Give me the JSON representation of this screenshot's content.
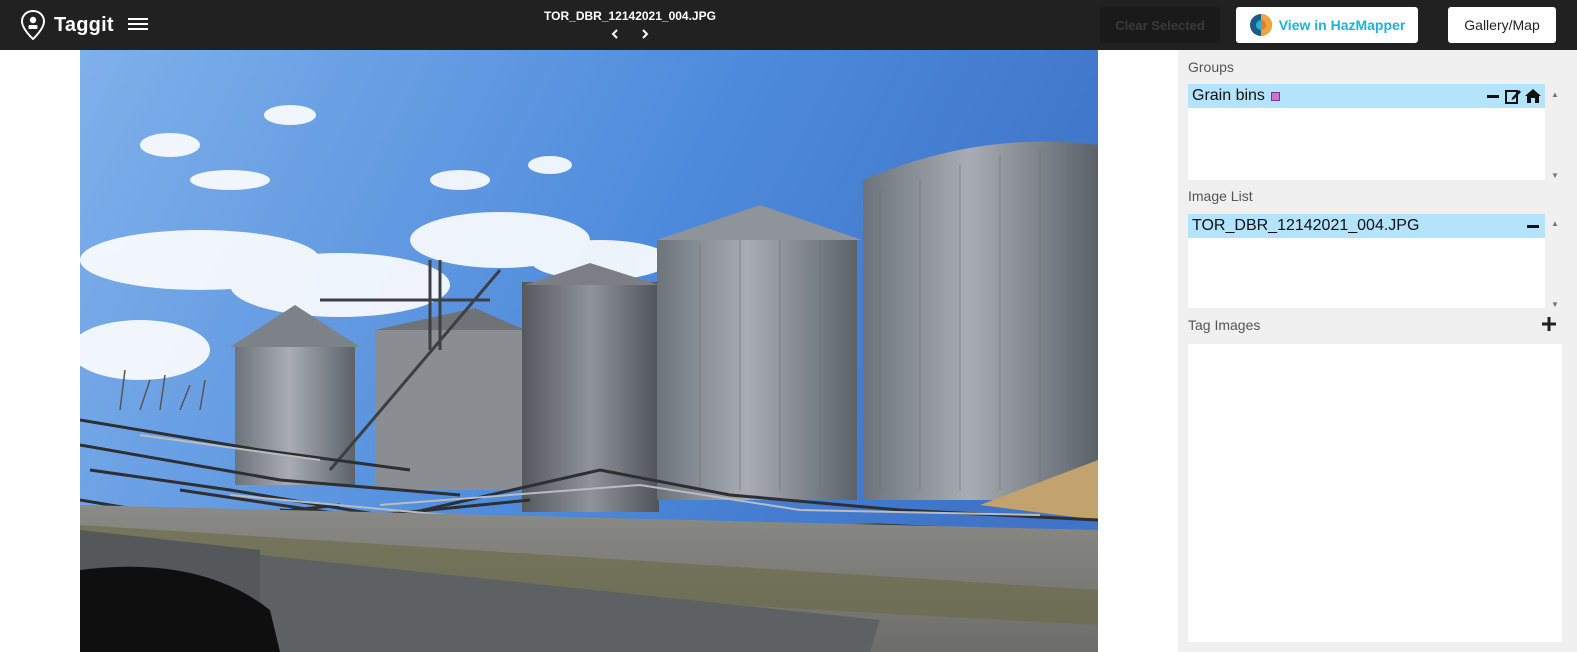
{
  "app": {
    "title": "Taggit"
  },
  "header": {
    "filename": "TOR_DBR_12142021_004.JPG",
    "clear_selected_label": "Clear Selected",
    "hazmapper_label": "View in HazMapper",
    "gallery_map_label": "Gallery/Map"
  },
  "icons": {
    "logo": "map-pin-icon",
    "menu": "hamburger-menu-icon",
    "prev": "chevron-left-icon",
    "next": "chevron-right-icon",
    "hazmapper": "hazmapper-logo-icon",
    "remove": "minus-icon",
    "edit": "edit-icon",
    "home": "home-icon",
    "add": "plus-icon"
  },
  "sidebar": {
    "groups_label": "Groups",
    "groups": [
      {
        "name": "Grain bins",
        "color": "#d36fd0"
      }
    ],
    "image_list_label": "Image List",
    "images": [
      {
        "name": "TOR_DBR_12142021_004.JPG"
      }
    ],
    "tag_images_label": "Tag Images"
  },
  "colors": {
    "topbar": "#212121",
    "row_highlight": "#b3e4fb",
    "hazmapper_accent": "#1fb3d4",
    "panel_bg": "#f0f0f0"
  }
}
